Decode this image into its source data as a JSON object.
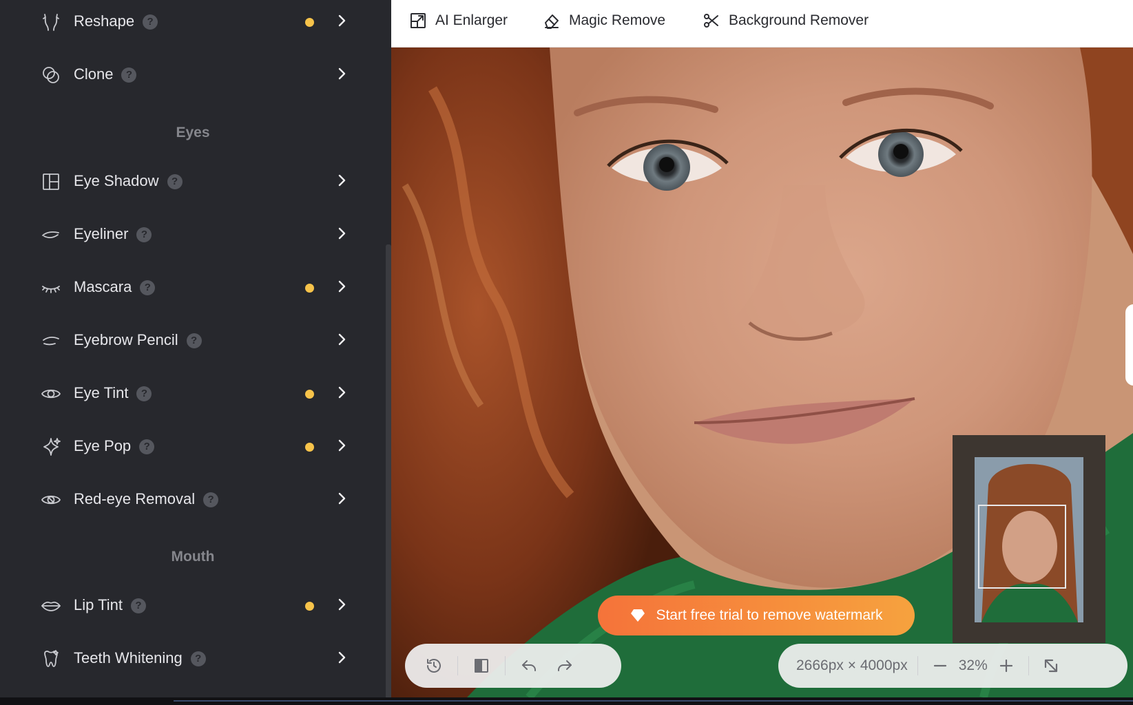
{
  "sidebar": {
    "sections": [
      {
        "heading": "Eyes"
      },
      {
        "heading": "Mouth"
      }
    ],
    "items": [
      {
        "label": "Reshape",
        "icon": "reshape-icon",
        "dot": true
      },
      {
        "label": "Clone",
        "icon": "clone-icon",
        "dot": false
      },
      {
        "label": "Eye Shadow",
        "icon": "eye-shadow-icon",
        "dot": false
      },
      {
        "label": "Eyeliner",
        "icon": "eyeliner-icon",
        "dot": false
      },
      {
        "label": "Mascara",
        "icon": "mascara-icon",
        "dot": true
      },
      {
        "label": "Eyebrow Pencil",
        "icon": "eyebrow-pencil-icon",
        "dot": false
      },
      {
        "label": "Eye Tint",
        "icon": "eye-tint-icon",
        "dot": true
      },
      {
        "label": "Eye Pop",
        "icon": "eye-pop-icon",
        "dot": true
      },
      {
        "label": "Red-eye Removal",
        "icon": "red-eye-removal-icon",
        "dot": false
      },
      {
        "label": "Lip Tint",
        "icon": "lip-tint-icon",
        "dot": true
      },
      {
        "label": "Teeth Whitening",
        "icon": "teeth-whitening-icon",
        "dot": false
      }
    ],
    "help_glyph": "?",
    "dot_color": "#f7c34a"
  },
  "toolbar": {
    "ai_enlarger": "AI Enlarger",
    "magic_remove": "Magic Remove",
    "background_remover": "Background Remover"
  },
  "canvas": {
    "watermark_cta": "Start free trial to remove watermark",
    "image_dimensions": "2666px × 4000px",
    "zoom_level": "32%"
  },
  "colors": {
    "sidebar_bg": "#27282d",
    "accent_orange": "#f5733a",
    "accent_yellow": "#f7c34a"
  }
}
